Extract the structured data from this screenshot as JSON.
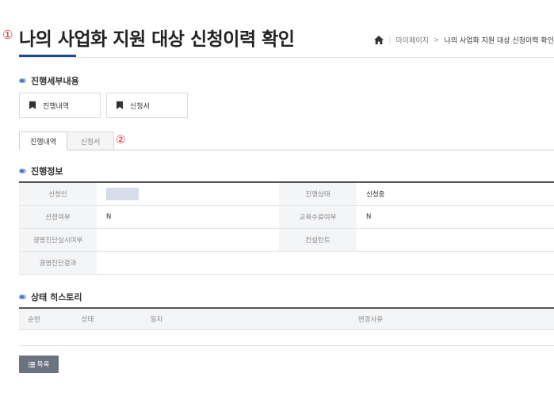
{
  "annotations": {
    "marker_1": "①",
    "marker_2": "②"
  },
  "page_title": "나의 사업화 지원 대상 신청이력 확인",
  "breadcrumb": {
    "separator": "|",
    "chevron": ">",
    "items": [
      "마이페이지",
      "나의 사업화 지원 대상 신청이력 확인"
    ]
  },
  "progress_detail": {
    "title": "진행세부내용",
    "buttons": [
      "진행내역",
      "신청서"
    ]
  },
  "tabs": [
    "진행내역",
    "신청서"
  ],
  "progress_info": {
    "title": "진행정보",
    "rows": [
      {
        "label1": "신청인",
        "value1": "",
        "label2": "진행상태",
        "value2": "신청중"
      },
      {
        "label1": "선정여부",
        "value1": "N",
        "label2": "교육수료여부",
        "value2": "N"
      },
      {
        "label1": "경영진단실시여부",
        "value1": "",
        "label2": "컨설턴트",
        "value2": ""
      },
      {
        "label1": "경영진단결과",
        "value1": ""
      }
    ]
  },
  "status_history": {
    "title": "상태 히스토리",
    "columns": [
      "순번",
      "상태",
      "일자",
      "변경사유"
    ]
  },
  "list_button": "목록",
  "colors": {
    "accent": "#1f4c8f",
    "marker": "#e0302c",
    "header_bg": "#f4f5f7",
    "button_bg": "#6b7280"
  },
  "icons": [
    "home-icon",
    "bookmark-icon",
    "list-icon",
    "section-bullet-icon"
  ]
}
